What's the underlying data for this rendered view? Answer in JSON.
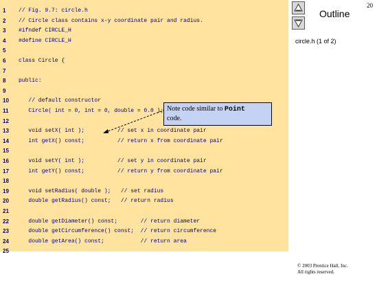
{
  "code_lines": [
    {
      "num": "1",
      "text": "// Fig. 9.7: circle.h"
    },
    {
      "num": "2",
      "text": "// Circle class contains x-y coordinate pair and radius."
    },
    {
      "num": "3",
      "text": "#ifndef CIRCLE_H"
    },
    {
      "num": "4",
      "text": "#define CIRCLE_H"
    },
    {
      "num": "5",
      "text": ""
    },
    {
      "num": "6",
      "text": "class Circle {"
    },
    {
      "num": "7",
      "text": ""
    },
    {
      "num": "8",
      "text": "public:"
    },
    {
      "num": "9",
      "text": ""
    },
    {
      "num": "10",
      "text": "   // default constructor"
    },
    {
      "num": "11",
      "text": "   Circle( int = 0, int = 0, double = 0.0 );"
    },
    {
      "num": "12",
      "text": ""
    },
    {
      "num": "13",
      "text": "   void setX( int );          // set x in coordinate pair"
    },
    {
      "num": "14",
      "text": "   int getX() const;          // return x from coordinate pair"
    },
    {
      "num": "15",
      "text": ""
    },
    {
      "num": "16",
      "text": "   void setY( int );          // set y in coordinate pair"
    },
    {
      "num": "17",
      "text": "   int getY() const;          // return y from coordinate pair"
    },
    {
      "num": "18",
      "text": ""
    },
    {
      "num": "19",
      "text": "   void setRadius( double );   // set radius"
    },
    {
      "num": "20",
      "text": "   double getRadius() const;   // return radius"
    },
    {
      "num": "21",
      "text": ""
    },
    {
      "num": "22",
      "text": "   double getDiameter() const;       // return diameter"
    },
    {
      "num": "23",
      "text": "   double getCircumference() const;  // return circumference"
    },
    {
      "num": "24",
      "text": "   double getArea() const;           // return area"
    },
    {
      "num": "25",
      "text": ""
    }
  ],
  "callout": {
    "text_before": "Note code similar to ",
    "code": "Point",
    "text_after": " code."
  },
  "sidebar": {
    "page_number": "20",
    "outline_label": "Outline",
    "file_label": "circle.h (1 of 2)",
    "up_button_icon": "up-triangle-icon",
    "down_button_icon": "down-triangle-icon"
  },
  "copyright": {
    "line1": "© 2003 Prentice Hall, Inc.",
    "line2": "All rights reserved."
  },
  "colors": {
    "code_background": "#ffe39f",
    "code_text": "#000080",
    "callout_background": "#c4d3f4"
  }
}
